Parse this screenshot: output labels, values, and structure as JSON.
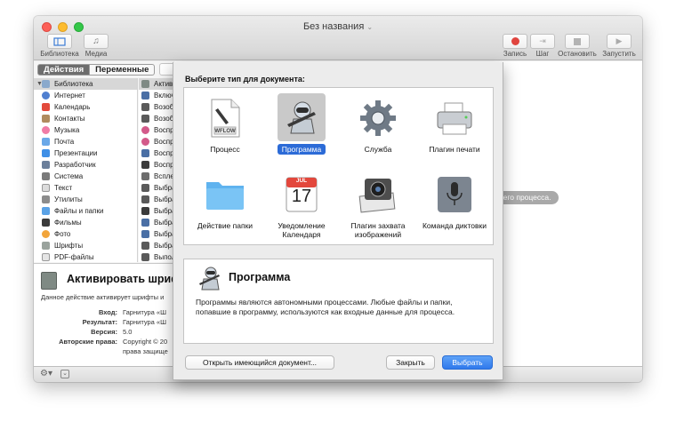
{
  "window": {
    "title": "Без названия",
    "toolbar": {
      "library": "Библиотека",
      "media": "Медиа",
      "record": "Запись",
      "step": "Шаг",
      "stop": "Остановить",
      "run": "Запустить"
    }
  },
  "sidebar": {
    "tabs": [
      "Действия",
      "Переменные"
    ],
    "categories": [
      "Библиотека",
      "Интернет",
      "Календарь",
      "Контакты",
      "Музыка",
      "Почта",
      "Презентации",
      "Разработчик",
      "Система",
      "Текст",
      "Утилиты",
      "Файлы и папки",
      "Фильмы",
      "Фото",
      "Шрифты",
      "PDF-файлы"
    ],
    "actions": [
      "Активи",
      "Включ",
      "Возоб",
      "Возоб",
      "Воспр",
      "Воспр",
      "Воспр",
      "Воспр",
      "Вспле",
      "Выбра",
      "Выбра",
      "Выбра",
      "Выбра",
      "Выбра",
      "Выбра",
      "Выпол"
    ]
  },
  "description": {
    "title": "Активировать шриф",
    "text": "Данное действие активирует шрифты и",
    "fields": [
      {
        "key": "Вход:",
        "value": "Гарнитура «Ш"
      },
      {
        "key": "Результат:",
        "value": "Гарнитура «Ш"
      },
      {
        "key": "Версия:",
        "value": "5.0"
      },
      {
        "key": "Авторские права:",
        "value": "Copyright © 20"
      },
      {
        "key": "",
        "value": "права защище"
      }
    ]
  },
  "workflow_hint": "ния Вашего процесса.",
  "sheet": {
    "prompt": "Выберите тип для документа:",
    "types": [
      {
        "label": "Процесс",
        "icon": "workflow-file-icon",
        "badge": "WFLOW"
      },
      {
        "label": "Программа",
        "icon": "automator-robot-icon",
        "selected": true
      },
      {
        "label": "Служба",
        "icon": "gear-icon"
      },
      {
        "label": "Плагин печати",
        "icon": "printer-icon"
      },
      {
        "label": "Действие папки",
        "icon": "folder-icon"
      },
      {
        "label": "Уведомление Календаря",
        "icon": "calendar-icon",
        "month": "JUL",
        "day": "17"
      },
      {
        "label": "Плагин захвата изображений",
        "icon": "image-capture-icon"
      },
      {
        "label": "Команда диктовки",
        "icon": "microphone-icon"
      }
    ],
    "info_title": "Программа",
    "info_text": "Программы являются автономными процессами. Любые файлы и папки, попавшие в программу, используются как входные данные для процесса.",
    "buttons": {
      "open": "Открыть имеющийся документ...",
      "close": "Закрыть",
      "choose": "Выбрать"
    }
  },
  "colors": {
    "accent": "#2f79ec",
    "close": "#fc5f57",
    "minimize": "#fdbc2e",
    "zoom": "#33c748",
    "record": "#e0443e"
  }
}
